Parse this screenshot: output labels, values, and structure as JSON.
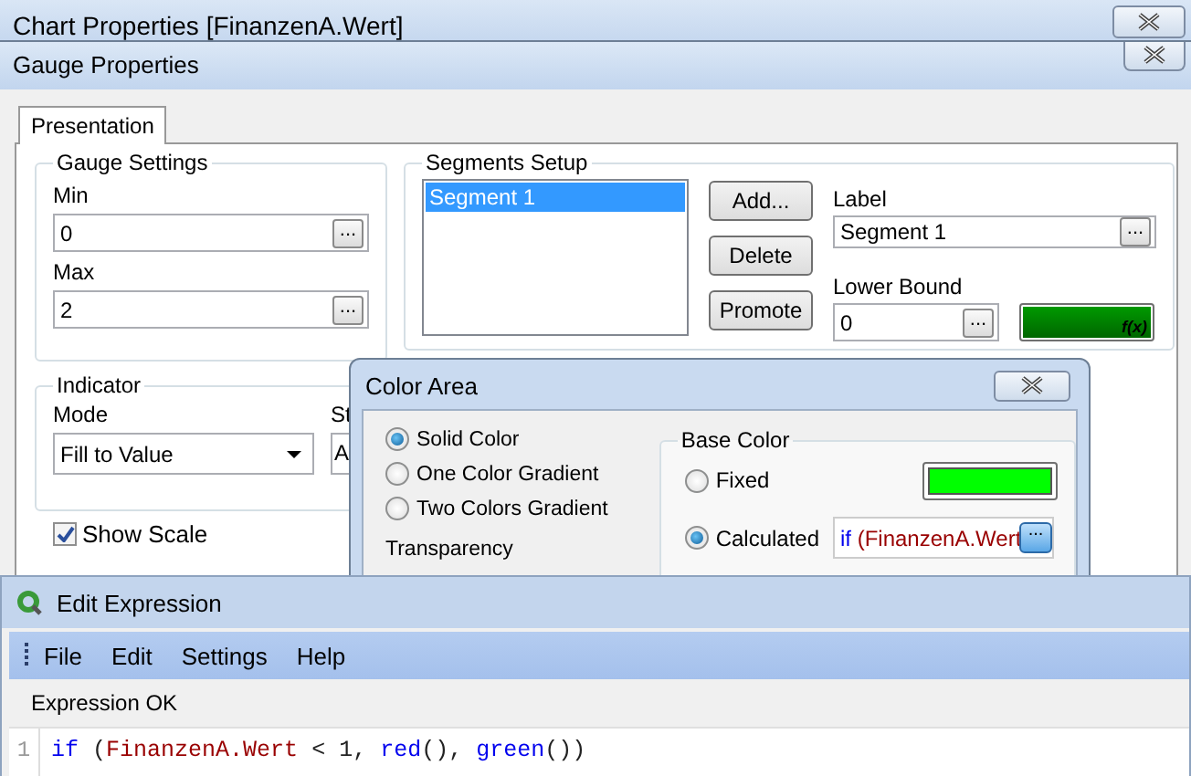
{
  "chart_properties_window": {
    "title": "Chart Properties [FinanzenA.Wert]"
  },
  "gauge_properties_window": {
    "title": "Gauge Properties",
    "tabs": [
      {
        "label": "Presentation",
        "selected": true
      }
    ],
    "gauge_settings": {
      "title": "Gauge Settings",
      "fields": [
        {
          "label": "Min",
          "value": "0"
        },
        {
          "label": "Max",
          "value": "2"
        }
      ]
    },
    "segments_setup": {
      "title": "Segments Setup",
      "segments": [
        {
          "label": "Segment 1",
          "selected": true
        }
      ],
      "buttons": [
        "Add...",
        "Delete",
        "Promote"
      ],
      "label_field": {
        "label": "Label",
        "value": "Segment 1"
      },
      "lower_bound": {
        "label": "Lower Bound",
        "value": "0",
        "color_button": "f(x)"
      }
    },
    "indicator": {
      "title": "Indicator",
      "mode": {
        "label": "Mode",
        "value": "Fill to Value"
      },
      "column_2": {
        "label": "St",
        "value": "A"
      }
    },
    "show_scale": {
      "label": "Show Scale",
      "checked": true
    }
  },
  "color_area_window": {
    "title": "Color Area",
    "options": [
      {
        "label": "Solid Color",
        "selected": true
      },
      {
        "label": "One Color Gradient",
        "selected": false
      },
      {
        "label": "Two Colors Gradient",
        "selected": false
      }
    ],
    "transparency_label": "Transparency",
    "base_color": {
      "title": "Base Color",
      "options": [
        {
          "label": "Fixed",
          "selected": false,
          "kind": "swatch"
        },
        {
          "label": "Calculated",
          "selected": true,
          "kind": "expression"
        }
      ],
      "expression": [
        {
          "text": "if",
          "kind": "keyword"
        },
        {
          "text": " (FinanzenA.Wert",
          "kind": "field"
        }
      ]
    }
  },
  "browse_button_label": "...",
  "edit_expression_window": {
    "title": "Edit Expression",
    "menu": [
      "File",
      "Edit",
      "Settings",
      "Help"
    ],
    "status": "Expression OK",
    "lines": [
      {
        "number": "1",
        "tokens": [
          {
            "text": "if",
            "kind": "keyword"
          },
          {
            "text": " (",
            "kind": "plain"
          },
          {
            "text": "FinanzenA.Wert",
            "kind": "field"
          },
          {
            "text": " < 1, ",
            "kind": "plain"
          },
          {
            "text": "red",
            "kind": "keyword"
          },
          {
            "text": "(), ",
            "kind": "plain"
          },
          {
            "text": "green",
            "kind": "keyword"
          },
          {
            "text": "())",
            "kind": "plain"
          }
        ]
      }
    ]
  }
}
